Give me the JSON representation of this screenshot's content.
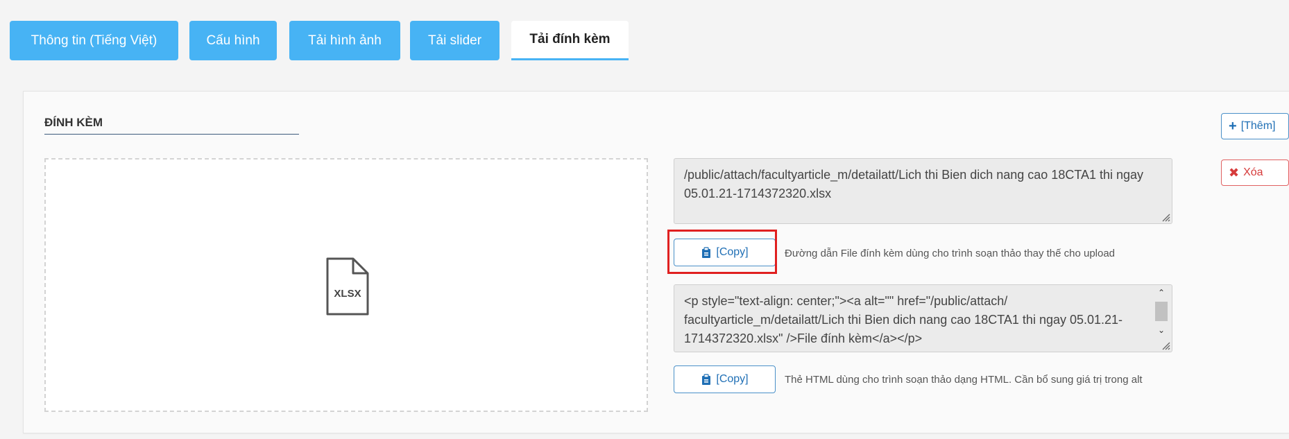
{
  "tabs": [
    {
      "label": "Thông tin (Tiếng Việt)"
    },
    {
      "label": "Cấu hình"
    },
    {
      "label": "Tải hình ảnh"
    },
    {
      "label": "Tải slider"
    },
    {
      "label": "Tải đính kèm"
    }
  ],
  "section": {
    "title": "ĐÍNH KÈM"
  },
  "attachment": {
    "file_ext": "XLSX",
    "path_value": "/public/attach/facultyarticle_m/detailatt/Lich thi Bien dich nang cao 18CTA1 thi ngay 05.01.21-1714372320.xlsx",
    "copy_path_label": "[Copy]",
    "copy_path_hint": "Đường dẫn File đính kèm dùng cho trình soạn thảo thay thế cho upload",
    "html_value": "<p style=\"text-align: center;\"><a alt=\"\" href=\"/public/attach/ facultyarticle_m/detailatt/Lich thi Bien dich nang cao 18CTA1 thi ngay 05.01.21-1714372320.xlsx\" />File đính kèm</a></p>",
    "copy_html_label": "[Copy]",
    "copy_html_hint": "Thẻ HTML dùng cho trình soạn thảo dạng HTML. Cần bổ sung giá trị trong alt"
  },
  "actions": {
    "add_label": "[Thêm]",
    "delete_label": "Xóa"
  },
  "colors": {
    "tab_bg": "#47b3f4",
    "link_blue": "#1f6fb5",
    "danger_red": "#d63b3b",
    "highlight_red": "#e02020"
  }
}
